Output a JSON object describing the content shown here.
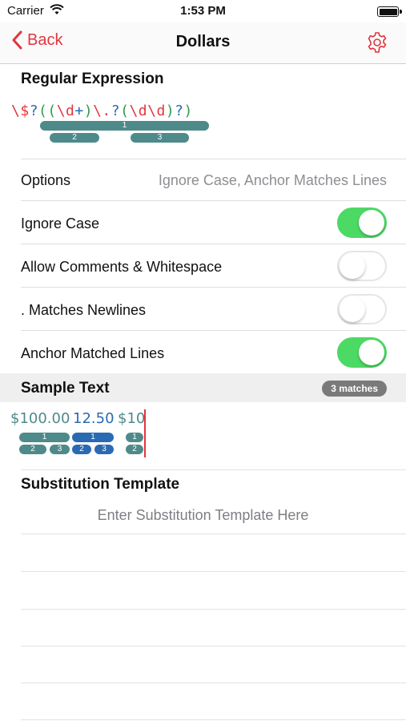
{
  "status_bar": {
    "carrier": "Carrier",
    "time": "1:53 PM"
  },
  "nav": {
    "back_label": "Back",
    "title": "Dollars"
  },
  "regex_section": {
    "title": "Regular Expression",
    "tokens": [
      {
        "text": "\\$",
        "color": "red"
      },
      {
        "text": "?",
        "color": "blue"
      },
      {
        "text": "((",
        "color": "green"
      },
      {
        "text": "\\d",
        "color": "red"
      },
      {
        "text": "+",
        "color": "blue"
      },
      {
        "text": ")",
        "color": "green"
      },
      {
        "text": "\\.",
        "color": "red"
      },
      {
        "text": "?",
        "color": "blue"
      },
      {
        "text": "(",
        "color": "green"
      },
      {
        "text": "\\d\\d",
        "color": "red"
      },
      {
        "text": ")",
        "color": "green"
      },
      {
        "text": "?",
        "color": "blue"
      },
      {
        "text": ")",
        "color": "green"
      }
    ],
    "groups": {
      "g1": "1",
      "g2": "2",
      "g3": "3"
    }
  },
  "options": {
    "label": "Options",
    "value": "Ignore Case, Anchor Matches Lines",
    "toggles": [
      {
        "label": "Ignore Case",
        "on": true
      },
      {
        "label": "Allow Comments & Whitespace",
        "on": false
      },
      {
        "label": ". Matches Newlines",
        "on": false
      },
      {
        "label": "Anchor Matched Lines",
        "on": true
      }
    ]
  },
  "sample": {
    "title": "Sample Text",
    "badge": "3 matches",
    "matches": [
      {
        "text": "$100.00",
        "g1": "1",
        "g2": "2",
        "g3": "3"
      },
      {
        "text": "12.50",
        "g1": "1",
        "g2": "2",
        "g3": "3"
      },
      {
        "text": "$10",
        "g1": "1",
        "g2": "2"
      }
    ]
  },
  "substitution": {
    "title": "Substitution Template",
    "placeholder": "Enter Substitution Template Here"
  },
  "colors": {
    "accent": "#e3353c",
    "token_red": "#e3353c",
    "token_blue": "#2a6ab3",
    "token_green": "#2f9a4a",
    "group_teal": "#4f8a8a",
    "group_blue": "#2a6ab3",
    "toggle_on": "#4cd964"
  }
}
